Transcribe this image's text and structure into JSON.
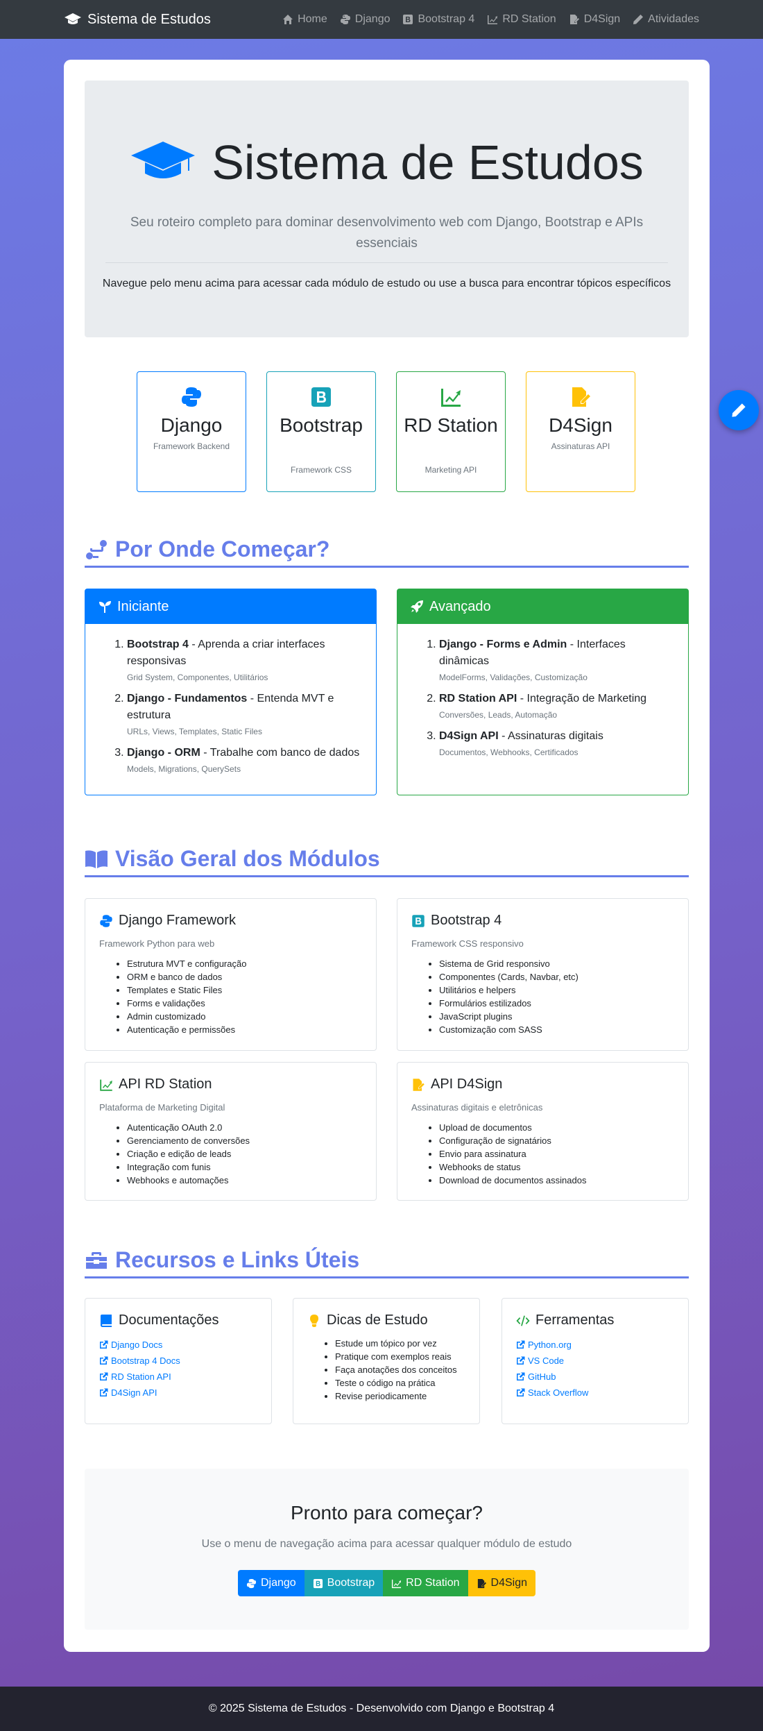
{
  "nav": {
    "brand": "Sistema de Estudos",
    "links": [
      {
        "label": "Home"
      },
      {
        "label": "Django"
      },
      {
        "label": "Bootstrap 4"
      },
      {
        "label": "RD Station"
      },
      {
        "label": "D4Sign"
      },
      {
        "label": "Atividades"
      }
    ]
  },
  "hero": {
    "title": "Sistema de Estudos",
    "lead": "Seu roteiro completo para dominar desenvolvimento web com Django, Bootstrap e APIs essenciais",
    "subtext": "Navegue pelo menu acima para acessar cada módulo de estudo ou use a busca para encontrar tópicos específicos"
  },
  "tiles": [
    {
      "title": "Django",
      "subtitle": "Framework Backend",
      "color": "#007bff"
    },
    {
      "title": "Bootstrap",
      "subtitle": "Framework CSS",
      "color": "#17a2b8"
    },
    {
      "title": "RD Station",
      "subtitle": "Marketing API",
      "color": "#28a745"
    },
    {
      "title": "D4Sign",
      "subtitle": "Assinaturas API",
      "color": "#ffc107"
    }
  ],
  "start": {
    "heading": "Por Onde Começar?",
    "beginner": {
      "title": "Iniciante",
      "color": "#007bff",
      "items": [
        {
          "name": "Bootstrap 4",
          "desc": " - Aprenda a criar interfaces responsivas",
          "tags": "Grid System, Componentes, Utilitários"
        },
        {
          "name": "Django - Fundamentos",
          "desc": " - Entenda MVT e estrutura",
          "tags": "URLs, Views, Templates, Static Files"
        },
        {
          "name": "Django - ORM",
          "desc": " - Trabalhe com banco de dados",
          "tags": "Models, Migrations, QuerySets"
        }
      ]
    },
    "advanced": {
      "title": "Avançado",
      "color": "#28a745",
      "items": [
        {
          "name": "Django - Forms e Admin",
          "desc": " - Interfaces dinâmicas",
          "tags": "ModelForms, Validações, Customização"
        },
        {
          "name": "RD Station API",
          "desc": " - Integração de Marketing",
          "tags": "Conversões, Leads, Automação"
        },
        {
          "name": "D4Sign API",
          "desc": " - Assinaturas digitais",
          "tags": "Documentos, Webhooks, Certificados"
        }
      ]
    }
  },
  "modules": {
    "heading": "Visão Geral dos Módulos",
    "cards": [
      {
        "title": "Django Framework",
        "subtitle": "Framework Python para web",
        "items": [
          "Estrutura MVT e configuração",
          "ORM e banco de dados",
          "Templates e Static Files",
          "Forms e validações",
          "Admin customizado",
          "Autenticação e permissões"
        ]
      },
      {
        "title": "Bootstrap 4",
        "subtitle": "Framework CSS responsivo",
        "items": [
          "Sistema de Grid responsivo",
          "Componentes (Cards, Navbar, etc)",
          "Utilitários e helpers",
          "Formulários estilizados",
          "JavaScript plugins",
          "Customização com SASS"
        ]
      },
      {
        "title": "API RD Station",
        "subtitle": "Plataforma de Marketing Digital",
        "items": [
          "Autenticação OAuth 2.0",
          "Gerenciamento de conversões",
          "Criação e edição de leads",
          "Integração com funis",
          "Webhooks e automações"
        ]
      },
      {
        "title": "API D4Sign",
        "subtitle": "Assinaturas digitais e eletrônicas",
        "items": [
          "Upload de documentos",
          "Configuração de signatários",
          "Envio para assinatura",
          "Webhooks de status",
          "Download de documentos assinados"
        ]
      }
    ]
  },
  "resources": {
    "heading": "Recursos e Links Úteis",
    "docs": {
      "title": "Documentações",
      "links": [
        "Django Docs",
        "Bootstrap 4 Docs",
        "RD Station API",
        "D4Sign API"
      ]
    },
    "tips": {
      "title": "Dicas de Estudo",
      "items": [
        "Estude um tópico por vez",
        "Pratique com exemplos reais",
        "Faça anotações dos conceitos",
        "Teste o código na prática",
        "Revise periodicamente"
      ]
    },
    "tools": {
      "title": "Ferramentas",
      "links": [
        "Python.org",
        "VS Code",
        "GitHub",
        "Stack Overflow"
      ]
    }
  },
  "cta": {
    "title": "Pronto para começar?",
    "subtitle": "Use o menu de navegação acima para acessar qualquer módulo de estudo",
    "buttons": [
      {
        "label": "Django",
        "color": "#007bff"
      },
      {
        "label": "Bootstrap",
        "color": "#17a2b8"
      },
      {
        "label": "RD Station",
        "color": "#28a745"
      },
      {
        "label": "D4Sign",
        "color": "#ffc107"
      }
    ]
  },
  "footer": {
    "text": "© 2025 Sistema de Estudos - Desenvolvido com Django e Bootstrap 4"
  }
}
